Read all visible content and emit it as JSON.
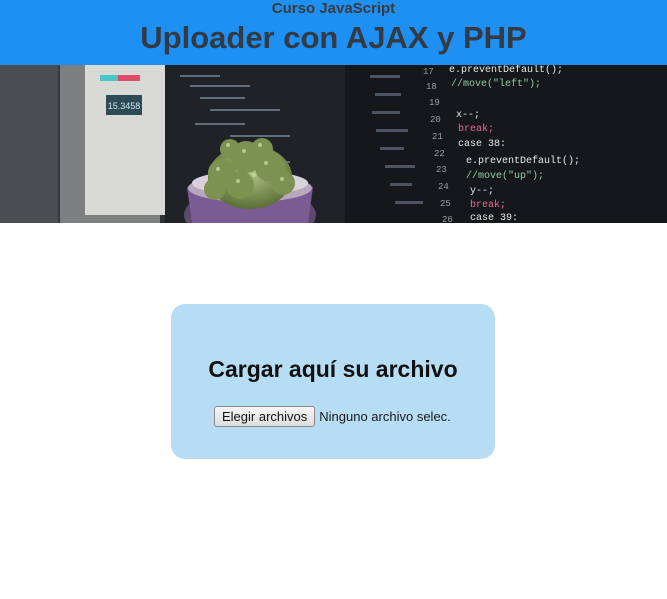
{
  "header": {
    "subtitle": "Curso JavaScript",
    "title": "Uploader con AJAX y PHP",
    "background_color": "#1e90f4"
  },
  "hero": {
    "image": "code-monitors-with-cactus-photo",
    "code_lines": [
      "e.preventDefault();",
      "//move(\"left\");",
      "x--;",
      "break;",
      "case 38:",
      "e.preventDefault();",
      "//move(\"up\");",
      "y--;",
      "break;",
      "case 39:"
    ],
    "line_numbers": [
      "17",
      "18",
      "19",
      "20",
      "21",
      "22",
      "23",
      "24",
      "25",
      "26"
    ],
    "small_screen_value": "15.3458"
  },
  "upload": {
    "title": "Cargar aquí su archivo",
    "button_label": "Elegir archivos",
    "status_text": "Ninguno archivo selec.",
    "card_color": "#b7ddf4"
  }
}
